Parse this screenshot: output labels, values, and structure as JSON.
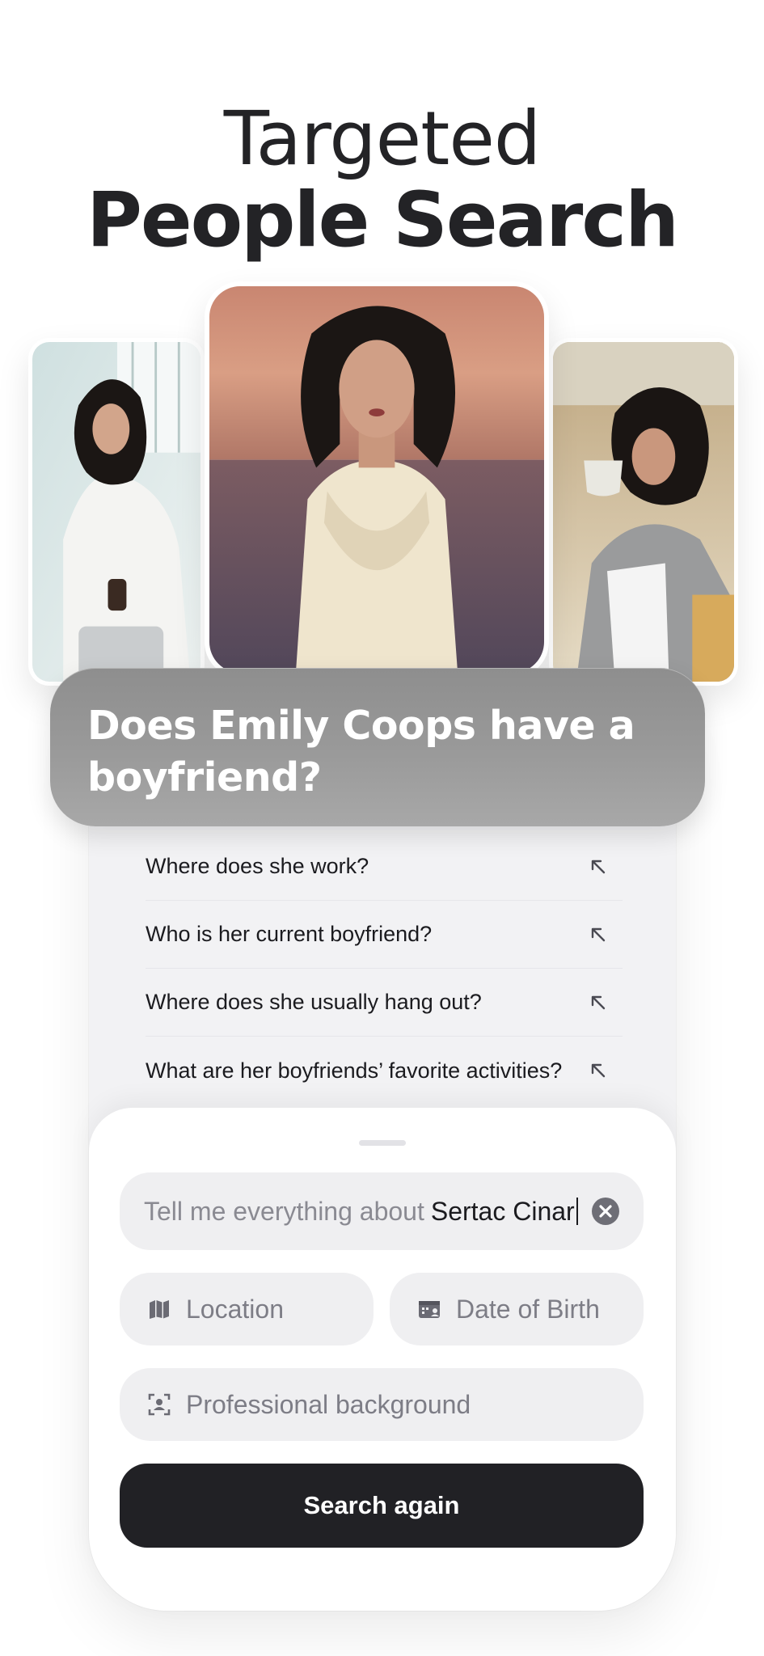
{
  "header": {
    "line1": "Targeted",
    "line2": "People Search"
  },
  "photos": {
    "left": "photo-woman-airport",
    "center": "photo-woman-sunset-sea",
    "right": "photo-woman-coffee"
  },
  "question": {
    "text": "Does Emily Coops have a boyfriend?"
  },
  "suggestions": [
    {
      "label": "Where does she work?",
      "icon": "arrow-up-left-icon"
    },
    {
      "label": "Who is her current boyfriend?",
      "icon": "arrow-up-left-icon"
    },
    {
      "label": "Where does she usually hang out?",
      "icon": "arrow-up-left-icon"
    },
    {
      "label": "What are her boyfriends’ favorite activities?",
      "icon": "arrow-up-left-icon"
    }
  ],
  "search": {
    "prefix": "Tell me everything about",
    "value": "Sertac Cinar",
    "clear_icon": "clear-icon"
  },
  "filters": {
    "location": "Location",
    "date_of_birth": "Date of Birth",
    "professional": "Professional background"
  },
  "actions": {
    "search_again": "Search again"
  },
  "colors": {
    "button_bg": "#212125",
    "field_bg": "#efeff1",
    "question_bg": "#999999"
  }
}
